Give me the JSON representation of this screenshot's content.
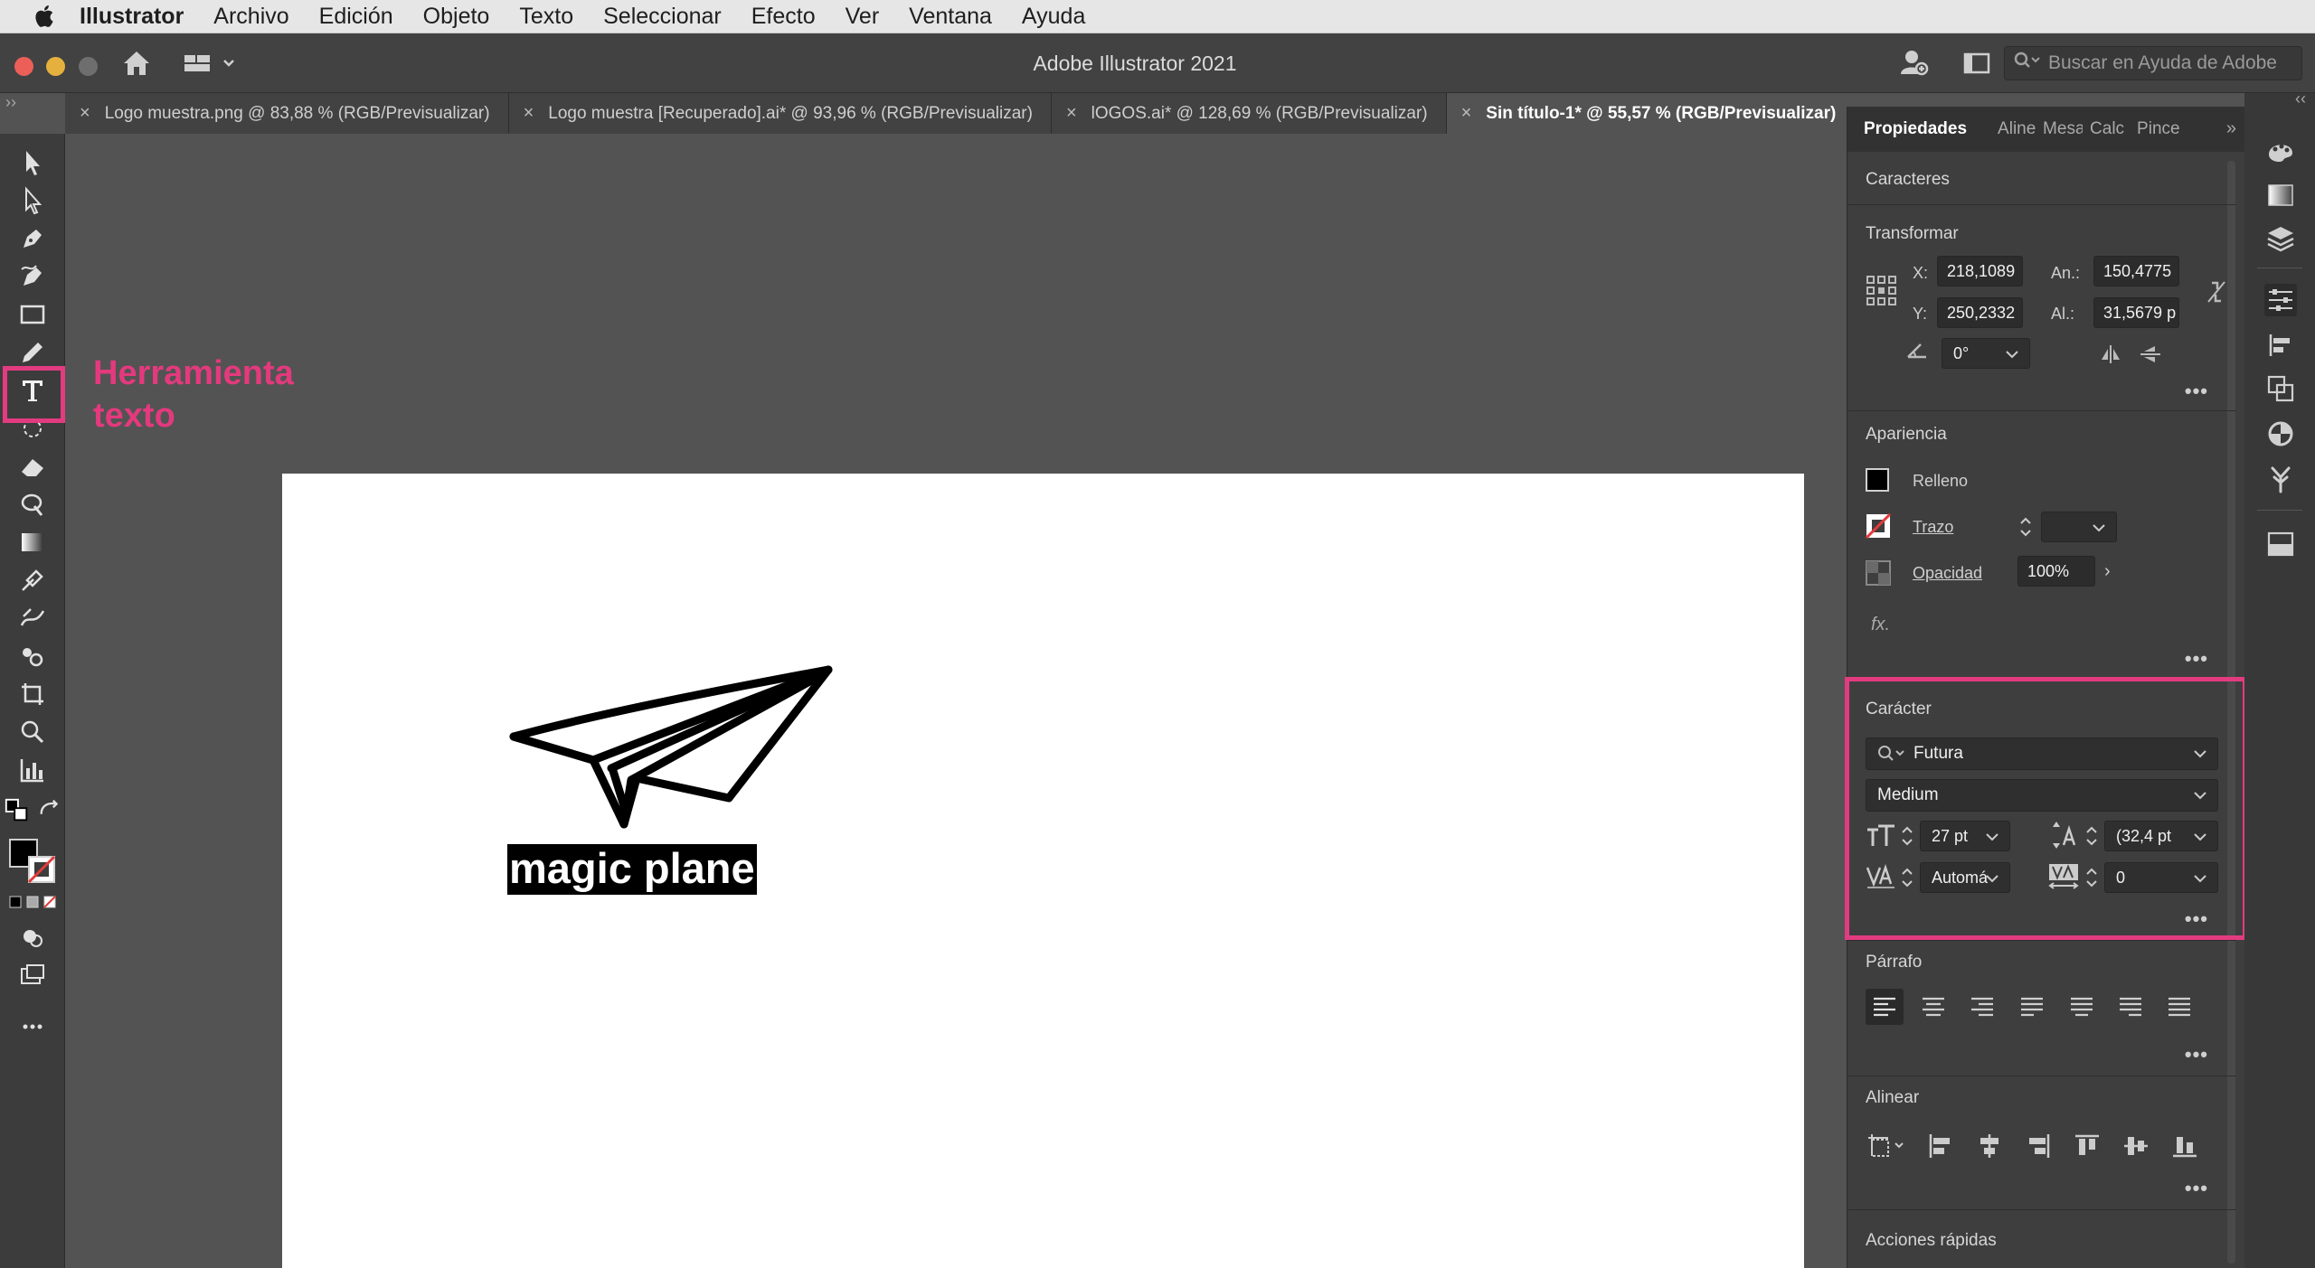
{
  "menubar": {
    "app_name": "Illustrator",
    "items": [
      "Archivo",
      "Edición",
      "Objeto",
      "Texto",
      "Seleccionar",
      "Efecto",
      "Ver",
      "Ventana",
      "Ayuda"
    ]
  },
  "titlebar": {
    "title": "Adobe Illustrator 2021",
    "help_search_placeholder": "Buscar en Ayuda de Adobe"
  },
  "tabs": [
    {
      "label": "Logo muestra.png @ 83,88 % (RGB/Previsualizar)"
    },
    {
      "label": "Logo muestra [Recuperado].ai* @ 93,96 % (RGB/Previsualizar)"
    },
    {
      "label": "lOGOS.ai* @ 128,69 % (RGB/Previsualizar)"
    },
    {
      "label": "Sin título-1* @ 55,57 % (RGB/Previsualizar)"
    }
  ],
  "annotation": {
    "line1": "Herramienta",
    "line2": "texto",
    "color": "#e3397d"
  },
  "artboard": {
    "logo_text": "magic plane"
  },
  "panel": {
    "tabs": [
      "Propiedades",
      "Aline",
      "Mesa",
      "Calc",
      "Pince"
    ],
    "selection_label": "Caracteres",
    "transform": {
      "title": "Transformar",
      "x_label": "X:",
      "x": "218,1089",
      "y_label": "Y:",
      "y": "250,2332",
      "w_label": "An.:",
      "w": "150,4775",
      "h_label": "Al.:",
      "h": "31,5679 p",
      "angle": "0°"
    },
    "appearance": {
      "title": "Apariencia",
      "fill_label": "Relleno",
      "stroke_label": "Trazo",
      "opacity_label": "Opacidad",
      "opacity": "100%",
      "fx": "fx."
    },
    "character": {
      "title": "Carácter",
      "font": "Futura",
      "style": "Medium",
      "size": "27 pt",
      "leading": "(32,4 pt",
      "kerning": "Automá",
      "tracking": "0"
    },
    "paragraph": {
      "title": "Párrafo"
    },
    "align": {
      "title": "Alinear"
    },
    "quick_actions": {
      "title": "Acciones rápidas"
    }
  },
  "colors": {
    "highlight": "#e33b80",
    "panel_bg": "#3e3e3e",
    "canvas_bg": "#535353"
  }
}
